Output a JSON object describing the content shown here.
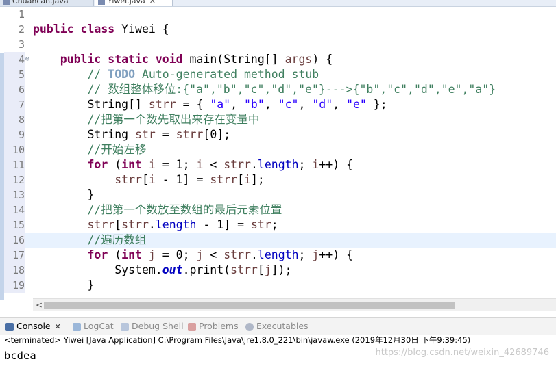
{
  "editor_tabs": [
    {
      "label": "Chuancan.java",
      "active": false
    },
    {
      "label": "Yiwei.java",
      "active": true
    }
  ],
  "code_lines": [
    {
      "num": "1",
      "tokens": []
    },
    {
      "num": "2",
      "tokens": [
        {
          "t": "kw",
          "v": "public"
        },
        {
          "t": "p",
          "v": " "
        },
        {
          "t": "kw",
          "v": "class"
        },
        {
          "t": "p",
          "v": " Yiwei {"
        }
      ]
    },
    {
      "num": "3",
      "tokens": []
    },
    {
      "num": "4",
      "fold": true,
      "tokens": [
        {
          "t": "p",
          "v": "    "
        },
        {
          "t": "kw",
          "v": "public"
        },
        {
          "t": "p",
          "v": " "
        },
        {
          "t": "kw",
          "v": "static"
        },
        {
          "t": "p",
          "v": " "
        },
        {
          "t": "kw",
          "v": "void"
        },
        {
          "t": "p",
          "v": " main(String[] "
        },
        {
          "t": "var",
          "v": "args"
        },
        {
          "t": "p",
          "v": ") {"
        }
      ]
    },
    {
      "num": "5",
      "tokens": [
        {
          "t": "cm",
          "v": "        // "
        },
        {
          "t": "todo",
          "v": "TODO"
        },
        {
          "t": "cm",
          "v": " Auto-generated method stub"
        }
      ]
    },
    {
      "num": "6",
      "tokens": [
        {
          "t": "cm",
          "v": "        // 数组整体移位:{\"a\",\"b\",\"c\",\"d\",\"e\"}--->{\"b\",\"c\",\"d\",\"e\",\"a\"}"
        }
      ]
    },
    {
      "num": "7",
      "tokens": [
        {
          "t": "p",
          "v": "        String[] "
        },
        {
          "t": "var",
          "v": "strr"
        },
        {
          "t": "p",
          "v": " = { "
        },
        {
          "t": "str",
          "v": "\"a\""
        },
        {
          "t": "p",
          "v": ", "
        },
        {
          "t": "str",
          "v": "\"b\""
        },
        {
          "t": "p",
          "v": ", "
        },
        {
          "t": "str",
          "v": "\"c\""
        },
        {
          "t": "p",
          "v": ", "
        },
        {
          "t": "str",
          "v": "\"d\""
        },
        {
          "t": "p",
          "v": ", "
        },
        {
          "t": "str",
          "v": "\"e\""
        },
        {
          "t": "p",
          "v": " };"
        }
      ]
    },
    {
      "num": "8",
      "tokens": [
        {
          "t": "cm",
          "v": "        //把第一个数先取出来存在变量中"
        }
      ]
    },
    {
      "num": "9",
      "tokens": [
        {
          "t": "p",
          "v": "        String "
        },
        {
          "t": "var",
          "v": "str"
        },
        {
          "t": "p",
          "v": " = "
        },
        {
          "t": "var",
          "v": "strr"
        },
        {
          "t": "p",
          "v": "[0];"
        }
      ]
    },
    {
      "num": "10",
      "tokens": [
        {
          "t": "cm",
          "v": "        //开始左移"
        }
      ]
    },
    {
      "num": "11",
      "tokens": [
        {
          "t": "p",
          "v": "        "
        },
        {
          "t": "kw",
          "v": "for"
        },
        {
          "t": "p",
          "v": " ("
        },
        {
          "t": "kw",
          "v": "int"
        },
        {
          "t": "p",
          "v": " "
        },
        {
          "t": "var",
          "v": "i"
        },
        {
          "t": "p",
          "v": " = 1; "
        },
        {
          "t": "var",
          "v": "i"
        },
        {
          "t": "p",
          "v": " < "
        },
        {
          "t": "var",
          "v": "strr"
        },
        {
          "t": "p",
          "v": "."
        },
        {
          "t": "fld",
          "v": "length"
        },
        {
          "t": "p",
          "v": "; "
        },
        {
          "t": "var",
          "v": "i"
        },
        {
          "t": "p",
          "v": "++) {"
        }
      ]
    },
    {
      "num": "12",
      "tokens": [
        {
          "t": "p",
          "v": "            "
        },
        {
          "t": "var",
          "v": "strr"
        },
        {
          "t": "p",
          "v": "["
        },
        {
          "t": "var",
          "v": "i"
        },
        {
          "t": "p",
          "v": " - 1] = "
        },
        {
          "t": "var",
          "v": "strr"
        },
        {
          "t": "p",
          "v": "["
        },
        {
          "t": "var",
          "v": "i"
        },
        {
          "t": "p",
          "v": "];"
        }
      ]
    },
    {
      "num": "13",
      "tokens": [
        {
          "t": "p",
          "v": "        }"
        }
      ]
    },
    {
      "num": "14",
      "tokens": [
        {
          "t": "cm",
          "v": "        //把第一个数放至数组的最后元素位置"
        }
      ]
    },
    {
      "num": "15",
      "tokens": [
        {
          "t": "p",
          "v": "        "
        },
        {
          "t": "var",
          "v": "strr"
        },
        {
          "t": "p",
          "v": "["
        },
        {
          "t": "var",
          "v": "strr"
        },
        {
          "t": "p",
          "v": "."
        },
        {
          "t": "fld",
          "v": "length"
        },
        {
          "t": "p",
          "v": " - 1] = "
        },
        {
          "t": "var",
          "v": "str"
        },
        {
          "t": "p",
          "v": ";"
        }
      ]
    },
    {
      "num": "16",
      "current": true,
      "caret": true,
      "tokens": [
        {
          "t": "cm",
          "v": "        //遍历数组"
        }
      ]
    },
    {
      "num": "17",
      "tokens": [
        {
          "t": "p",
          "v": "        "
        },
        {
          "t": "kw",
          "v": "for"
        },
        {
          "t": "p",
          "v": " ("
        },
        {
          "t": "kw",
          "v": "int"
        },
        {
          "t": "p",
          "v": " "
        },
        {
          "t": "var",
          "v": "j"
        },
        {
          "t": "p",
          "v": " = 0; "
        },
        {
          "t": "var",
          "v": "j"
        },
        {
          "t": "p",
          "v": " < "
        },
        {
          "t": "var",
          "v": "strr"
        },
        {
          "t": "p",
          "v": "."
        },
        {
          "t": "fld",
          "v": "length"
        },
        {
          "t": "p",
          "v": "; "
        },
        {
          "t": "var",
          "v": "j"
        },
        {
          "t": "p",
          "v": "++) {"
        }
      ]
    },
    {
      "num": "18",
      "tokens": [
        {
          "t": "p",
          "v": "            System."
        },
        {
          "t": "sfld",
          "v": "out"
        },
        {
          "t": "p",
          "v": ".print("
        },
        {
          "t": "var",
          "v": "strr"
        },
        {
          "t": "p",
          "v": "["
        },
        {
          "t": "var",
          "v": "j"
        },
        {
          "t": "p",
          "v": "]);"
        }
      ]
    },
    {
      "num": "19",
      "tokens": [
        {
          "t": "p",
          "v": "        }"
        }
      ]
    }
  ],
  "views": [
    {
      "label": "Console",
      "active": true,
      "icon": "console-icon",
      "color": "#4a6fa5",
      "closable": true
    },
    {
      "label": "LogCat",
      "active": false,
      "icon": "logcat-icon",
      "color": "#9bb7d9"
    },
    {
      "label": "Debug Shell",
      "active": false,
      "icon": "debug-shell-icon",
      "color": "#b8c6dc"
    },
    {
      "label": "Problems",
      "active": false,
      "icon": "problems-icon",
      "color": "#d9a0a0"
    },
    {
      "label": "Executables",
      "active": false,
      "icon": "executables-icon",
      "color": "#b0b8c8"
    }
  ],
  "console": {
    "status": "<terminated> Yiwei [Java Application] C:\\Program Files\\Java\\jre1.8.0_221\\bin\\javaw.exe (2019年12月30日 下午9:39:45)",
    "output": "bcdea"
  },
  "watermark": "https://blog.csdn.net/weixin_42689746",
  "colors": {
    "keyword": "#7f0055",
    "string": "#2a00ff",
    "comment": "#3f7f5f",
    "field": "#0000c0",
    "current_line": "#e8f2fe"
  }
}
